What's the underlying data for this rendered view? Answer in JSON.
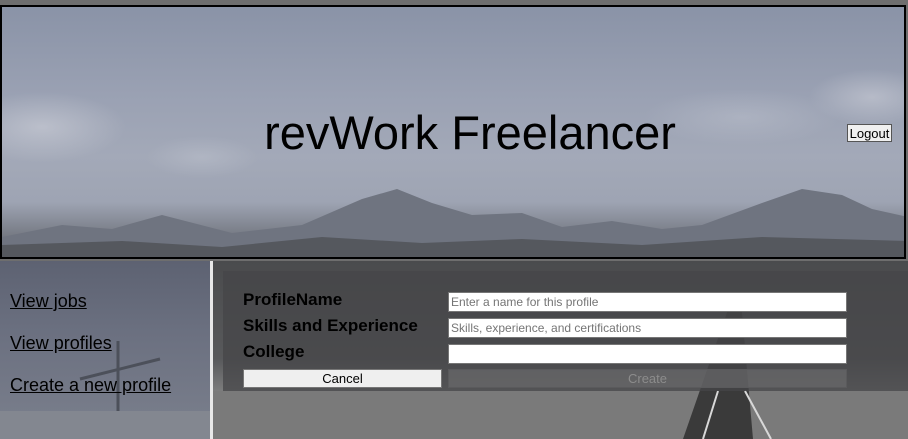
{
  "header": {
    "title": "revWork Freelancer",
    "logout_label": "Logout"
  },
  "sidebar": {
    "links": [
      {
        "label": "View jobs"
      },
      {
        "label": "View profiles"
      },
      {
        "label": "Create a new profile"
      }
    ]
  },
  "form": {
    "fields": [
      {
        "label": "ProfileName",
        "value": "",
        "placeholder": "Enter a name for this profile"
      },
      {
        "label": "Skills and Experience",
        "value": "",
        "placeholder": "Skills, experience, and certifications"
      },
      {
        "label": "College",
        "value": "",
        "placeholder": ""
      }
    ],
    "cancel_label": "Cancel",
    "create_label": "Create",
    "create_disabled": true
  }
}
